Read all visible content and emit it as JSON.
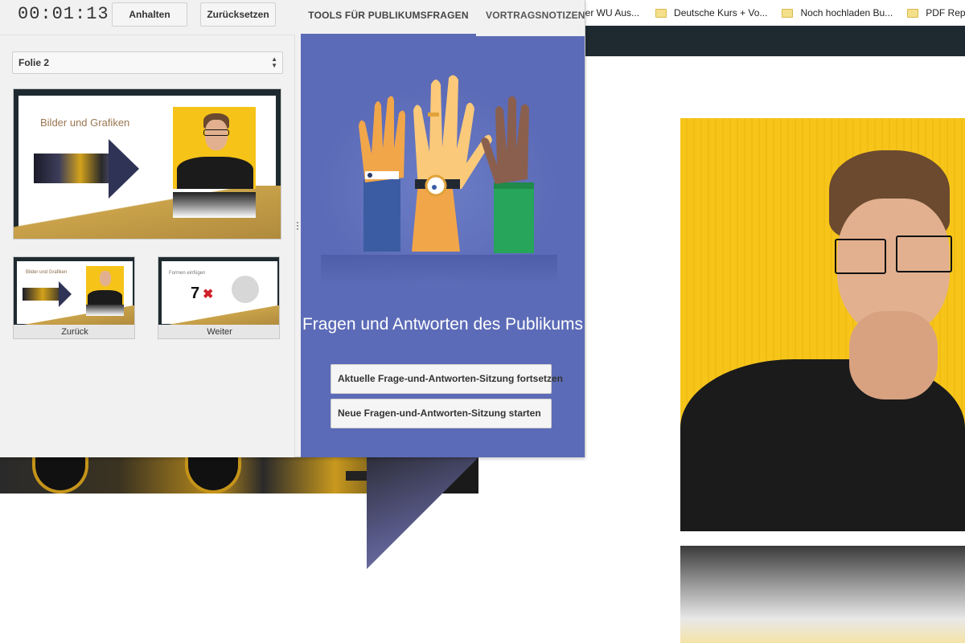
{
  "bookmarks": {
    "items": [
      {
        "label": "ner WU Aus...",
        "folder": false
      },
      {
        "label": "Deutsche Kurs + Vo...",
        "folder": true
      },
      {
        "label": "Noch hochladen Bu...",
        "folder": true
      },
      {
        "label": "PDF Repor",
        "folder": true
      }
    ]
  },
  "presenter": {
    "timer": "00:01:13",
    "pause_label": "Anhalten",
    "reset_label": "Zurücksetzen",
    "slide_select": "Folie 2",
    "current_slide": {
      "title": "Bilder und Grafiken"
    },
    "prev_slide": {
      "title": "Bilder und Grafiken",
      "caption": "Zurück"
    },
    "next_slide": {
      "title": "Formen einfügen",
      "number": "7",
      "mark": "✖",
      "caption": "Weiter"
    }
  },
  "tabs": {
    "qa_tab": "TOOLS FÜR PUBLIKUMSFRAGEN",
    "notes_tab": "VORTRAGSNOTIZEN"
  },
  "qa": {
    "title": "Fragen und Antworten des Publikums",
    "continue_button": "Aktuelle Frage-und-Antworten-Sitzung fortsetzen",
    "start_button": "Neue Fragen-und-Antworten-Sitzung starten"
  },
  "colors": {
    "accent": "#5c6bb7",
    "tab_underline": "#5c6bb5",
    "slide_frame": "#1e2a30",
    "photo_background": "#f6c319"
  }
}
